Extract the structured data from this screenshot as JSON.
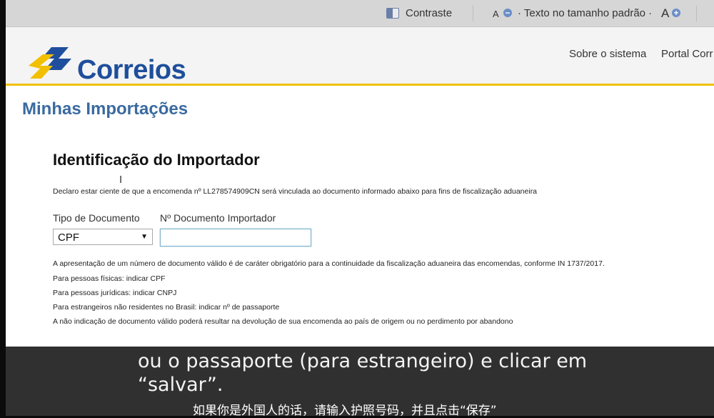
{
  "topbar": {
    "contrast_label": "Contraste",
    "font_decrease_label": "A",
    "font_status": "· Texto no tamanho padrão ·",
    "font_increase_label": "A"
  },
  "header": {
    "logo_text": "Correios",
    "nav": [
      {
        "label": "Sobre o sistema"
      },
      {
        "label": "Portal Corr"
      }
    ]
  },
  "page": {
    "title": "Minhas Importações",
    "section_title": "Identificação do Importador",
    "declaration": "Declaro estar ciente de que a encomenda nº LL278574909CN será vinculada ao documento informado abaixo para fins de fiscalização aduaneira",
    "form": {
      "doc_type_label": "Tipo de Documento",
      "doc_type_value": "CPF",
      "doc_number_label": "Nº Documento Importador",
      "doc_number_value": ""
    },
    "notes": [
      "A apresentação de um número de documento válido é de caráter obrigatório para a continuidade da fiscalização aduaneira das encomendas, conforme IN 1737/2017.",
      "Para pessoas físicas: indicar CPF",
      "Para pessoas jurídicas: indicar CNPJ",
      "Para estrangeiros não residentes no Brasil: indicar nº de passaporte",
      "A não indicação de documento válido poderá resultar na devolução de sua encomenda ao país de origem ou no perdimento por abandono"
    ]
  },
  "subtitles": {
    "pt_line1": "ou o passaporte (para estrangeiro) e clicar em",
    "pt_line2": "“salvar”.",
    "cn": "如果你是外国人的话，请输入护照号码，并且点击“保存”"
  },
  "colors": {
    "brand_blue": "#1f4f9c",
    "brand_yellow": "#f2c000",
    "title_blue": "#3a6aa0"
  }
}
